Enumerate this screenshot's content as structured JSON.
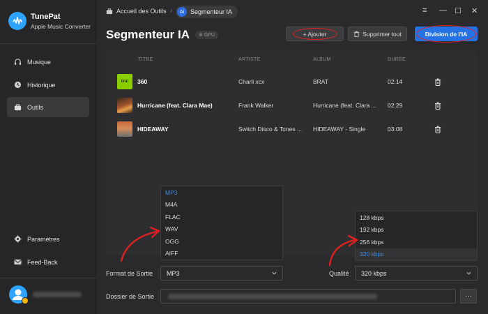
{
  "app": {
    "brand_name": "TunePat",
    "brand_sub": "Apple Music Converter",
    "accent": "#2472e3"
  },
  "sidebar": {
    "items": [
      {
        "label": "Musique",
        "icon": "headphones-icon"
      },
      {
        "label": "Historique",
        "icon": "clock-icon"
      },
      {
        "label": "Outils",
        "icon": "toolbox-icon",
        "active": true
      }
    ],
    "bottom": [
      {
        "label": "Paramètres",
        "icon": "gear-icon"
      },
      {
        "label": "Feed-Back",
        "icon": "mail-icon"
      }
    ]
  },
  "breadcrumb": {
    "home": "Accueil des Outils",
    "separator": "›",
    "ai_badge": "Ai",
    "current": "Segmenteur IA"
  },
  "window": {
    "menu": "≡",
    "minimize": "—",
    "maximize": "☐",
    "close": "✕"
  },
  "header": {
    "title": "Segmenteur IA",
    "gpu_badge": "GPU",
    "add_label": "+ Ajouter",
    "delete_all_label": "Supprimer tout",
    "ai_split_label": "Division de l'IA"
  },
  "table": {
    "columns": [
      "TITRE",
      "ARTISTE",
      "ALBUM",
      "DURÉE"
    ],
    "rows": [
      {
        "art_text": "brat",
        "title": "360",
        "artist": "Charli xcx",
        "album": "BRAT",
        "duration": "02:14"
      },
      {
        "art_text": "",
        "title": "Hurricane (feat. Clara Mae)",
        "artist": "Frank Walker",
        "album": "Hurricane (feat. Clara ...",
        "duration": "02:29"
      },
      {
        "art_text": "",
        "title": "HIDEAWAY",
        "artist": "Switch Disco & Tones ...",
        "album": "HIDEAWAY - Single",
        "duration": "03:08"
      }
    ]
  },
  "format_dropdown": {
    "options": [
      "MP3",
      "M4A",
      "FLAC",
      "WAV",
      "OGG",
      "AIFF"
    ],
    "selected": "MP3"
  },
  "quality_dropdown": {
    "options": [
      "128 kbps",
      "192 kbps",
      "256 kbps",
      "320 kbps"
    ],
    "selected": "320 kbps"
  },
  "output": {
    "format_label": "Format de Sortie",
    "format_value": "MP3",
    "quality_label": "Qualité",
    "quality_value": "320 kbps",
    "folder_label": "Dossier de Sortie",
    "browse_label": "···"
  }
}
